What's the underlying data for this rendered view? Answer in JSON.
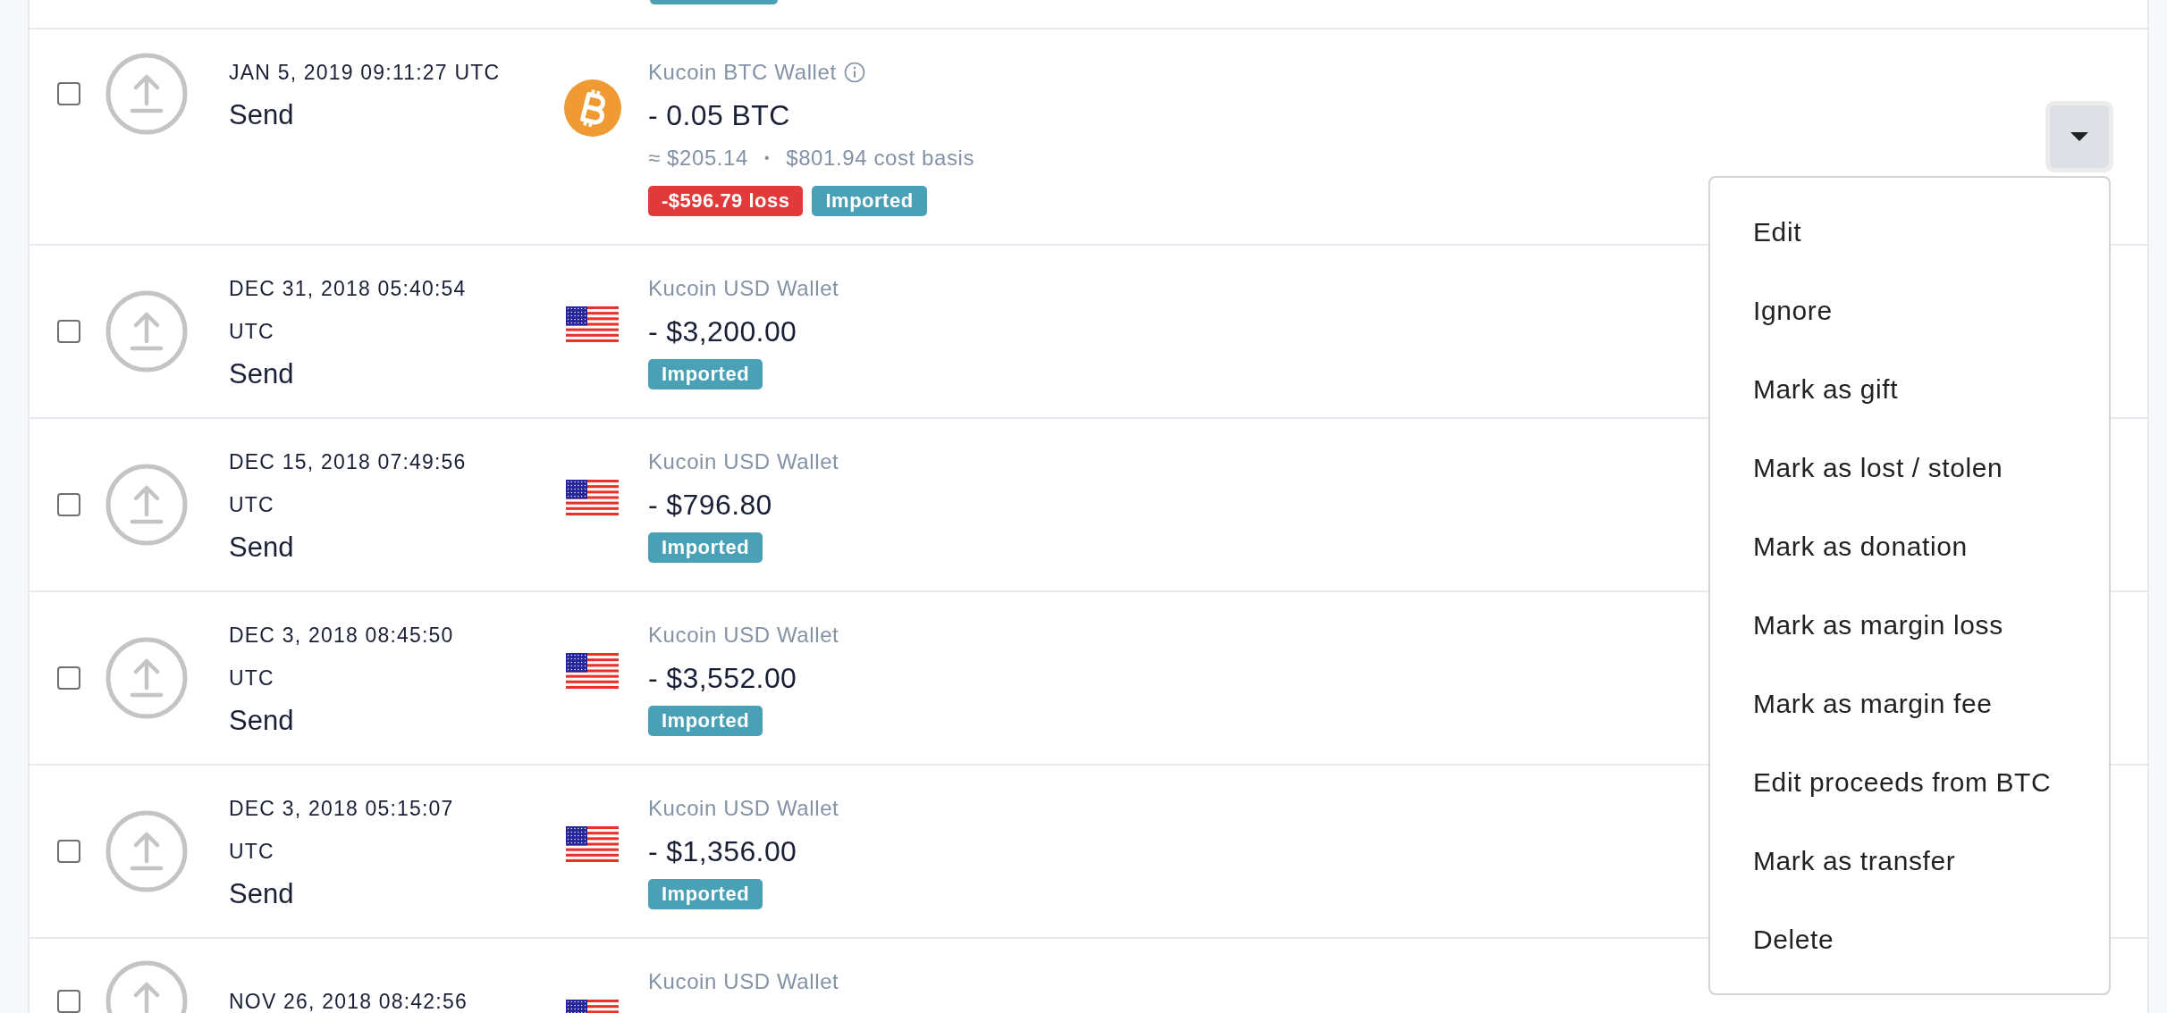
{
  "partial_row": {
    "tags": [
      {
        "kind": "imported"
      }
    ]
  },
  "rows": [
    {
      "checked": false,
      "date_lines": [
        "JAN 5, 2019 09:11:27 UTC"
      ],
      "type": "Send",
      "kind": "btc",
      "wallet": "Kucoin BTC Wallet",
      "wallet_info": true,
      "amount": "- 0.05 BTC",
      "value": "≈ $205.14",
      "separator": "•",
      "cost_basis": "$801.94 cost basis",
      "tags": [
        {
          "label": "-$596.79 loss",
          "kind": "loss"
        },
        {
          "label": "Imported",
          "kind": "imported"
        }
      ],
      "menu_open": true
    },
    {
      "checked": false,
      "date_lines": [
        "DEC 31, 2018 05:40:54",
        "UTC"
      ],
      "type": "Send",
      "kind": "usd",
      "wallet": "Kucoin USD Wallet",
      "wallet_info": false,
      "amount": "- $3,200.00",
      "tags": [
        {
          "label": "Imported",
          "kind": "imported"
        }
      ],
      "menu_open": false
    },
    {
      "checked": false,
      "date_lines": [
        "DEC 15, 2018 07:49:56",
        "UTC"
      ],
      "type": "Send",
      "kind": "usd",
      "wallet": "Kucoin USD Wallet",
      "wallet_info": false,
      "amount": "- $796.80",
      "tags": [
        {
          "label": "Imported",
          "kind": "imported"
        }
      ],
      "menu_open": false
    },
    {
      "checked": false,
      "date_lines": [
        "DEC 3, 2018 08:45:50",
        "UTC"
      ],
      "type": "Send",
      "kind": "usd",
      "wallet": "Kucoin USD Wallet",
      "wallet_info": false,
      "amount": "- $3,552.00",
      "tags": [
        {
          "label": "Imported",
          "kind": "imported"
        }
      ],
      "menu_open": false
    },
    {
      "checked": false,
      "date_lines": [
        "DEC 3, 2018 05:15:07",
        "UTC"
      ],
      "type": "Send",
      "kind": "usd",
      "wallet": "Kucoin USD Wallet",
      "wallet_info": false,
      "amount": "- $1,356.00",
      "tags": [
        {
          "label": "Imported",
          "kind": "imported"
        }
      ],
      "menu_open": false
    },
    {
      "checked": false,
      "date_lines": [
        "NOV 26, 2018 08:42:56"
      ],
      "kind": "usd",
      "wallet": "Kucoin USD Wallet",
      "wallet_info": false,
      "menu_open": false
    }
  ],
  "menu": [
    "Edit",
    "Ignore",
    "Mark as gift",
    "Mark as lost / stolen",
    "Mark as donation",
    "Mark as margin loss",
    "Mark as margin fee",
    "Edit proceeds from BTC",
    "Mark as transfer",
    "Delete"
  ]
}
